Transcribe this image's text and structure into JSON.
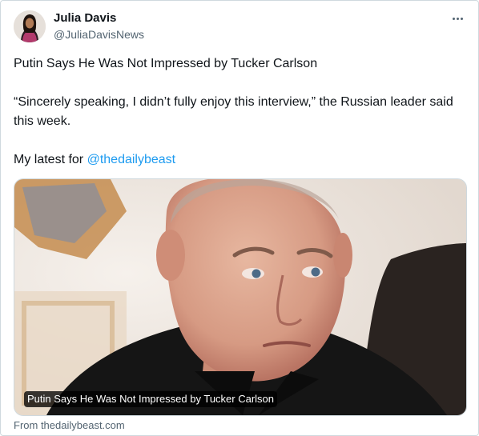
{
  "author": {
    "name": "Julia Davis",
    "handle": "@JuliaDavisNews"
  },
  "tweet": {
    "headline": "Putin Says He Was Not Impressed by Tucker Carlson",
    "quote": "“Sincerely speaking, I didn’t fully enjoy this interview,” the Russian leader said this week.",
    "latest_prefix": "My latest for ",
    "mention": "@thedailybeast"
  },
  "link_card": {
    "caption": "Putin Says He Was Not Impressed by Tucker Carlson",
    "source": "From thedailybeast.com"
  },
  "icons": {
    "more": "more-options-icon"
  },
  "colors": {
    "accent": "#1d9bf0",
    "secondary_text": "#536471",
    "border": "#cfd9de"
  }
}
